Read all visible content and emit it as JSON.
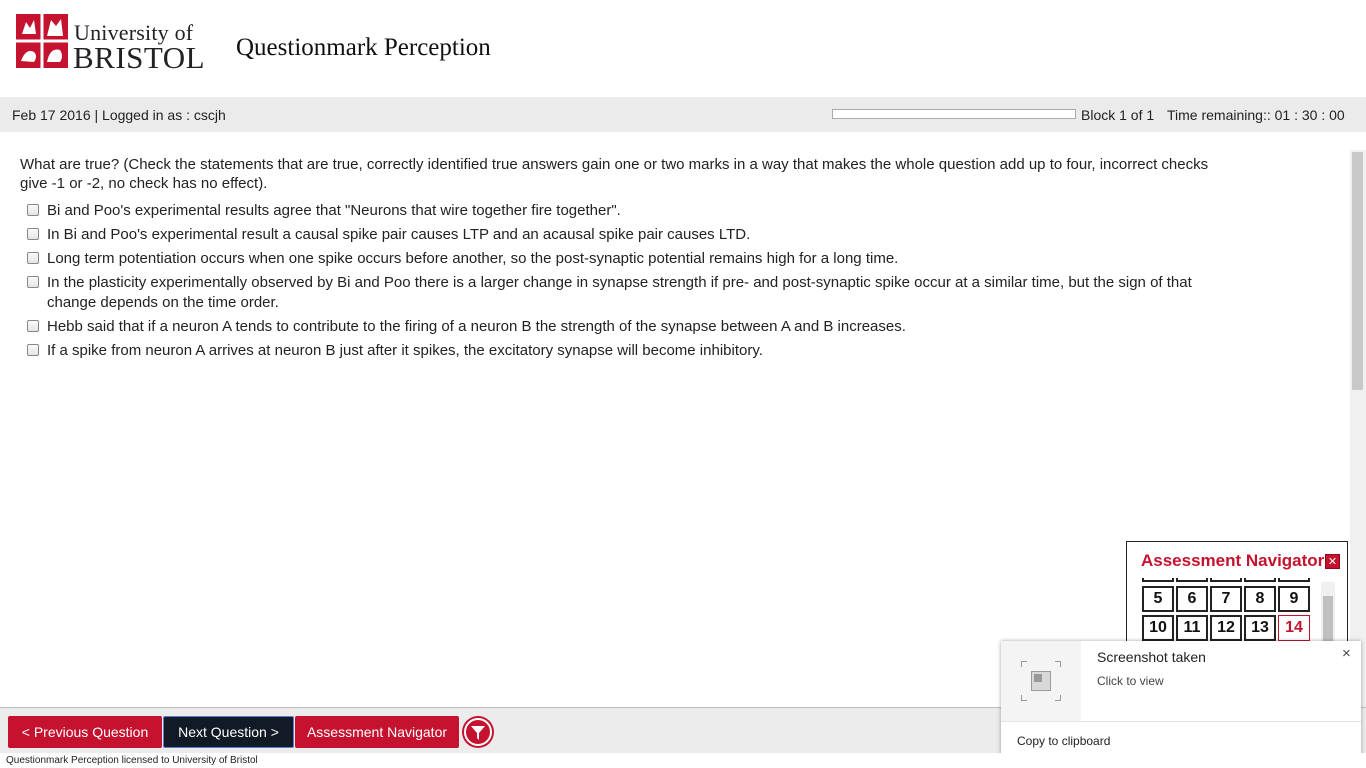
{
  "header": {
    "logo_line1": "University of",
    "logo_line2": "BRISTOL",
    "app_title": "Questionmark Perception"
  },
  "status": {
    "date_login": "Feb 17 2016 | Logged in as : cscjh",
    "block": "Block 1 of 1",
    "time_remaining": "Time remaining:: 01 : 30 : 00",
    "progress_fraction": 0.0
  },
  "question": {
    "prompt": "What are true? (Check the statements that are true, correctly identified true answers gain one or two marks in a way that makes the whole question add up to four, incorrect checks give -1 or -2, no check has no effect).",
    "options": [
      "Bi and Poo's experimental results agree that \"Neurons that wire together fire together\".",
      "In Bi and Poo's experimental result a causal spike pair causes LTP and an acausal spike pair causes LTD.",
      "Long term potentiation occurs when one spike occurs before another, so the post-synaptic potential remains high for a long time.",
      "In the plasticity experimentally observed by Bi and Poo there is a larger change in synapse strength if pre- and post-synaptic spike occur at a similar time, but the sign of that change depends on the time order.",
      "Hebb said that if a neuron A tends to contribute to the firing of a neuron B the strength of the synapse between A and B increases.",
      "If a spike from neuron A arrives at neuron B just after it spikes, the excitatory synapse will become inhibitory."
    ]
  },
  "navigator": {
    "title": "Assessment Navigator",
    "close_label": "✕",
    "row1": [
      "5",
      "6",
      "7",
      "8",
      "9"
    ],
    "row2": [
      "10",
      "11",
      "12",
      "13",
      "14"
    ],
    "current": "14"
  },
  "toast": {
    "title": "Screenshot taken",
    "subtitle": "Click to view",
    "close": "×",
    "copy": "Copy to clipboard"
  },
  "bottom": {
    "prev": "< Previous Question",
    "next": "Next Question >",
    "navigator": "Assessment Navigator"
  },
  "footer": {
    "text": "Questionmark Perception licensed to University of Bristol"
  },
  "colors": {
    "brand_red": "#c4122f",
    "next_button": "#121a26"
  }
}
